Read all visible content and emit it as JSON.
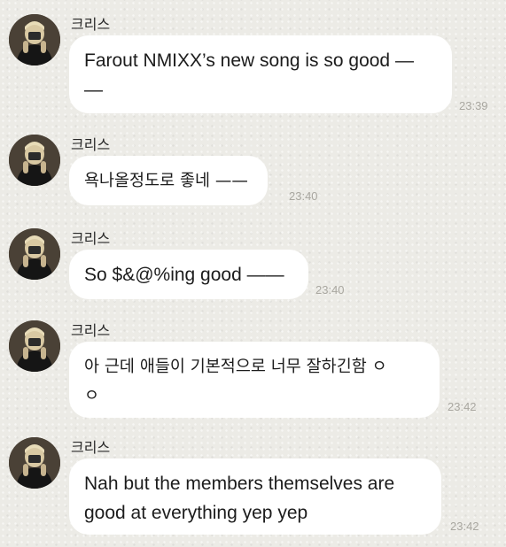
{
  "chat": {
    "messages": [
      {
        "sender": "크리스",
        "text": "Farout NMIXX's new song is so good —\n—",
        "text_line1": "Farout NMIXX’s new song is so good —",
        "text_line2": "—",
        "time": "23:39",
        "avatar_icon": "profile-photo"
      },
      {
        "sender": "크리스",
        "text": "욕나올정도로 좋네 ——",
        "time": "23:40",
        "avatar_icon": "profile-photo"
      },
      {
        "sender": "크리스",
        "text": "So $&@%ing good ——",
        "time": "23:40",
        "avatar_icon": "profile-photo"
      },
      {
        "sender": "크리스",
        "text_line1": "아 근데 애들이 기본적으로 너무 잘하긴함 ㅇ",
        "text_line2": "ㅇ",
        "time": "23:42",
        "avatar_icon": "profile-photo"
      },
      {
        "sender": "크리스",
        "text_line1": "Nah but the members themselves are",
        "text_line2": "good at everything yep yep",
        "time": "23:42",
        "avatar_icon": "profile-photo"
      }
    ]
  },
  "colors": {
    "background": "#ecebe6",
    "bubble": "#ffffff",
    "timestamp": "#a9a7a0",
    "text": "#1c1c1c"
  }
}
